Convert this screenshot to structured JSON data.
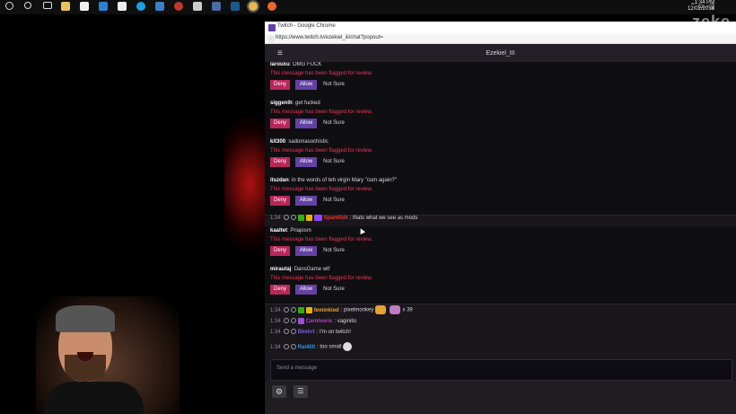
{
  "taskbar": {
    "icons": [
      "power-icon",
      "search-icon",
      "task-view-icon",
      "file-explorer-icon",
      "store-icon",
      "mail-icon",
      "document-icon",
      "skype-icon",
      "app-icon",
      "game-icon",
      "app2-icon",
      "steam-icon",
      "chrome-icon",
      "firefox-icon"
    ],
    "clock_time": "1:34 PM",
    "clock_date": "12/02/2016"
  },
  "brand": {
    "text": "zeke"
  },
  "window": {
    "title": "Twitch - Google Chrome",
    "url": "https://www.twitch.tv/ezekiel_iii/chat?popout="
  },
  "chat": {
    "channel": "Ezekiel_III",
    "flag_notice": "This message has been flagged for review.",
    "deny_label": "Deny",
    "allow_label": "Allow",
    "notsure_label": "Not Sure",
    "flagged": [
      {
        "user": "larouxu",
        "message": "OMG FUCK"
      },
      {
        "user": "siggenih",
        "message": "get fucked"
      },
      {
        "user": "kit300",
        "message": "sadomasochistic"
      },
      {
        "user": "itszdan",
        "message": "in the words of teh virgin Mary \"cum again?\""
      },
      {
        "user": "kaaltet",
        "message": "Priapism"
      },
      {
        "user": "mirautaj",
        "message": "DansGame wtf"
      }
    ],
    "messages": [
      {
        "time": "1:34",
        "user": "Spamfish",
        "user_color": "#e03b3b",
        "message": "thats what we see as mods"
      },
      {
        "time": "1:34",
        "user": "feminkied",
        "user_color": "#e8a030",
        "message": "pixelmonkey",
        "suffix": "x 39"
      },
      {
        "time": "1:34",
        "user": "Carnivoris",
        "user_color": "#c23bd4",
        "message": "vaginitis"
      },
      {
        "time": "1:34",
        "user": "Bkehrt",
        "user_color": "#7c5cd6",
        "message": "I'm on twitch!"
      },
      {
        "time": "1:34",
        "user": "Rai400",
        "user_color": "#3b8fe0",
        "message": "too small"
      }
    ],
    "input_placeholder": "Send a message"
  },
  "colors": {
    "deny": "#b8275a",
    "allow": "#6441a4",
    "flag": "#e9365a",
    "bg": "#19171c"
  }
}
